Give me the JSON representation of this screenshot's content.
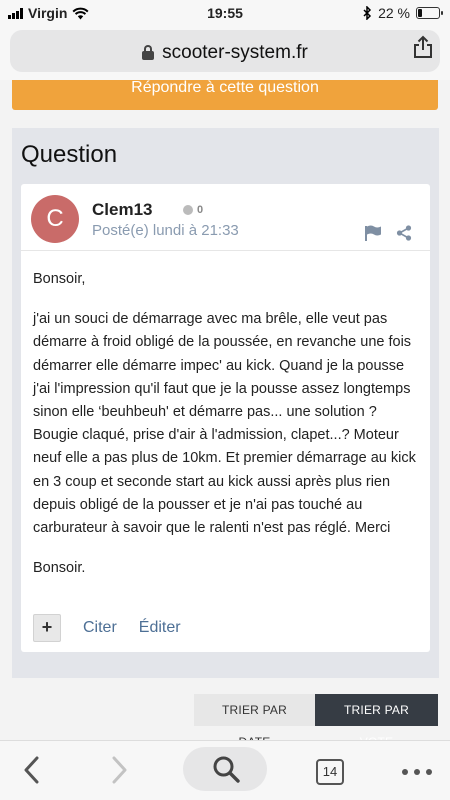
{
  "status_bar": {
    "carrier": "Virgin",
    "time": "19:55",
    "battery_percent": "22 %",
    "battery_level": 0.22
  },
  "browser": {
    "url": "scooter-system.fr",
    "tab_count": "14"
  },
  "page": {
    "reply_button": "Répondre à cette question",
    "section_title": "Question",
    "post": {
      "avatar_letter": "C",
      "author": "Clem13",
      "reputation": "0",
      "posted": "Posté(e) lundi à 21:33",
      "body": [
        "Bonsoir,",
        "j'ai un souci de démarrage avec ma brêle, elle veut pas démarre à froid obligé de la poussée, en revanche une fois démarrer elle démarre impec' au kick. Quand je la pousse j'ai l'impression qu'il faut que je la pousse assez longtemps sinon elle ‘beuhbeuh' et démarre pas... une solution ? Bougie claqué, prise d'air à l'admission, clapet...? Moteur neuf elle a pas plus de 10km. Et premier démarrage au kick en 3 coup et seconde start au kick aussi après plus rien depuis obligé de la pousser et je n'ai pas touché au carburateur à savoir que le ralenti n'est pas réglé. Merci",
        "Bonsoir."
      ],
      "quote_label": "Citer",
      "edit_label": "Éditer"
    },
    "sort": {
      "by_date": "TRIER PAR DATE",
      "by_vote": "TRIER PAR VOTE"
    }
  },
  "colors": {
    "accent_orange": "#f0a33c",
    "avatar": "#c96b69",
    "link": "#4d6f95",
    "sort_active": "#363c44"
  }
}
